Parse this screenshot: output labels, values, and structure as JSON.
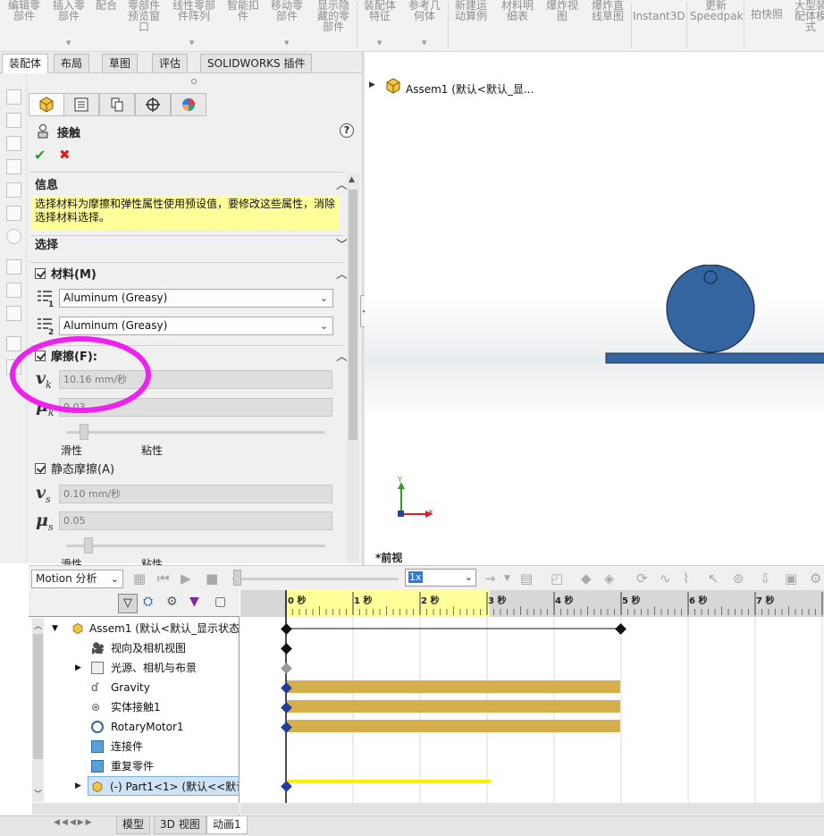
{
  "ribbon": {
    "items": [
      {
        "label": "编辑零\n部件"
      },
      {
        "label": "插入零\n部件"
      },
      {
        "label": "配合"
      },
      {
        "label": "零部件\n预览窗\n口"
      },
      {
        "label": "线性零部\n件阵列"
      },
      {
        "label": "智能扣\n件"
      },
      {
        "label": "移动零\n部件"
      },
      {
        "label": "显示隐\n藏的零\n部件"
      },
      {
        "label": "装配体\n特征"
      },
      {
        "label": "参考几\n何体"
      },
      {
        "label": "新建运\n动算例"
      },
      {
        "label": "材料明\n细表"
      },
      {
        "label": "爆炸视\n图"
      },
      {
        "label": "爆炸直\n线草图"
      },
      {
        "label": "Instant3D"
      },
      {
        "label": "更新\nSpeedpak"
      },
      {
        "label": "拍快照"
      },
      {
        "label": "大型装\n配体模\n式"
      }
    ]
  },
  "tabs": [
    "装配体",
    "布局",
    "草图",
    "评估",
    "SOLIDWORKS 插件"
  ],
  "pm": {
    "title": "接触",
    "info_header": "信息",
    "info_text": "选择材料为摩擦和弹性属性使用预设值，要修改这些属性，消除选择材料选择。",
    "selection_header": "选择",
    "material_header": "材料(M)",
    "material1": "Aluminum (Greasy)",
    "material2": "Aluminum (Greasy)",
    "friction_header": "摩擦(F):",
    "vk_value": "10.16 mm/秒",
    "uk_value": "0.03",
    "slider_left": "滑性",
    "slider_right": "粘性",
    "static_header": "静态摩擦(A)",
    "vs_value": "0.10 mm/秒",
    "us_value": "0.05",
    "slider2_left": "滑性",
    "slider2_right": "粘性",
    "kinetic_friction_level": 0.05,
    "static_friction_level": 0.07
  },
  "graphics": {
    "tree_root": "Assem1  (默认<默认_显...",
    "view_label": "*前视",
    "axis_y": "Y",
    "axis_x": "X"
  },
  "motion": {
    "study_type": "Motion 分析",
    "speed": "1x",
    "tree": [
      {
        "label": "Assem1  (默认<默认_显示状态"
      },
      {
        "label": "视向及相机视图"
      },
      {
        "label": "光源、相机与布景"
      },
      {
        "label": "Gravity"
      },
      {
        "label": "实体接触1"
      },
      {
        "label": "RotaryMotor1"
      },
      {
        "label": "连接件"
      },
      {
        "label": "重复零件"
      },
      {
        "label": "(-) Part1<1> (默认<<默认"
      }
    ],
    "ticks": [
      "0 秒",
      "1 秒",
      "2 秒",
      "3 秒",
      "4 秒",
      "5 秒",
      "6 秒",
      "7 秒"
    ]
  },
  "bottom_tabs": [
    "模型",
    "3D 视图",
    "动画1"
  ],
  "colors": {
    "highlight_yellow": "#ffff99",
    "timeline_bar": "#d4af4c",
    "ball_blue": "#3565a0",
    "annotation_magenta": "#ee22ee"
  }
}
